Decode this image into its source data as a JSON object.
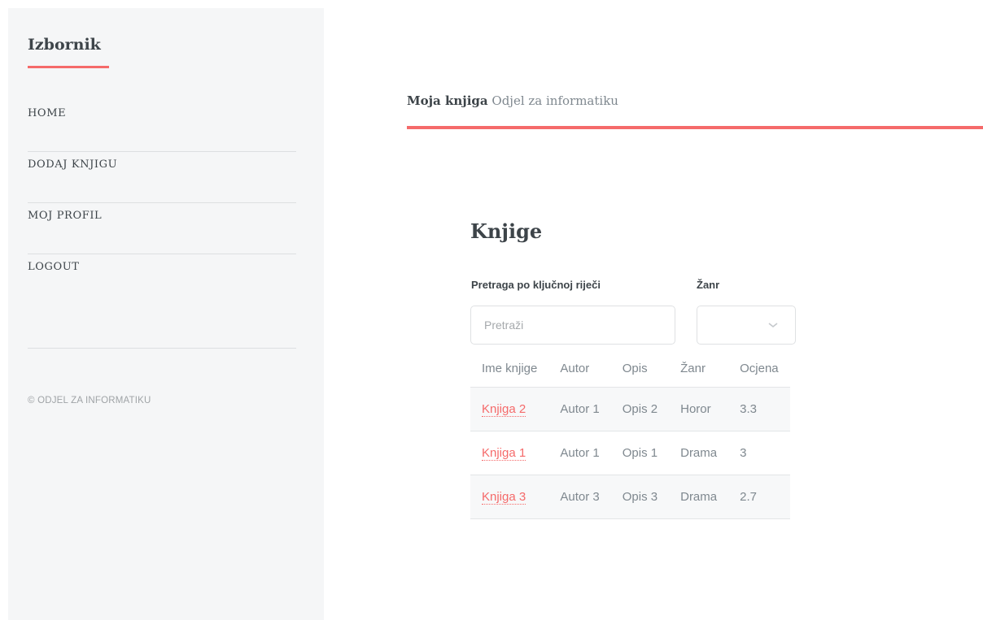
{
  "sidebar": {
    "title": "Izbornik",
    "items": [
      {
        "label": "HOME"
      },
      {
        "label": "DODAJ KNJIGU"
      },
      {
        "label": "MOJ PROFIL"
      },
      {
        "label": "LOGOUT"
      }
    ],
    "copyright": "© ODJEL ZA INFORMATIKU"
  },
  "header": {
    "brand": "Moja knjiga",
    "subtitle": "Odjel za informatiku"
  },
  "main": {
    "title": "Knjige",
    "search": {
      "label": "Pretraga po ključnoj riječi",
      "placeholder": "Pretraži",
      "value": ""
    },
    "genre": {
      "label": "Žanr",
      "selected": ""
    },
    "table": {
      "columns": [
        "Ime knjige",
        "Autor",
        "Opis",
        "Žanr",
        "Ocjena"
      ],
      "rows": [
        {
          "name": "Knjiga 2",
          "author": "Autor 1",
          "description": "Opis 2",
          "genre": "Horor",
          "rating": "3.3"
        },
        {
          "name": "Knjiga 1",
          "author": "Autor 1",
          "description": "Opis 1",
          "genre": "Drama",
          "rating": "3"
        },
        {
          "name": "Knjiga 3",
          "author": "Autor 3",
          "description": "Opis 3",
          "genre": "Drama",
          "rating": "2.7"
        }
      ]
    }
  },
  "colors": {
    "accent": "#f56a6a",
    "sidebar_bg": "#f5f6f7",
    "text": "#3d4449",
    "muted": "#7f888f"
  },
  "icons": {
    "genre_select": "chevron-down-icon"
  }
}
